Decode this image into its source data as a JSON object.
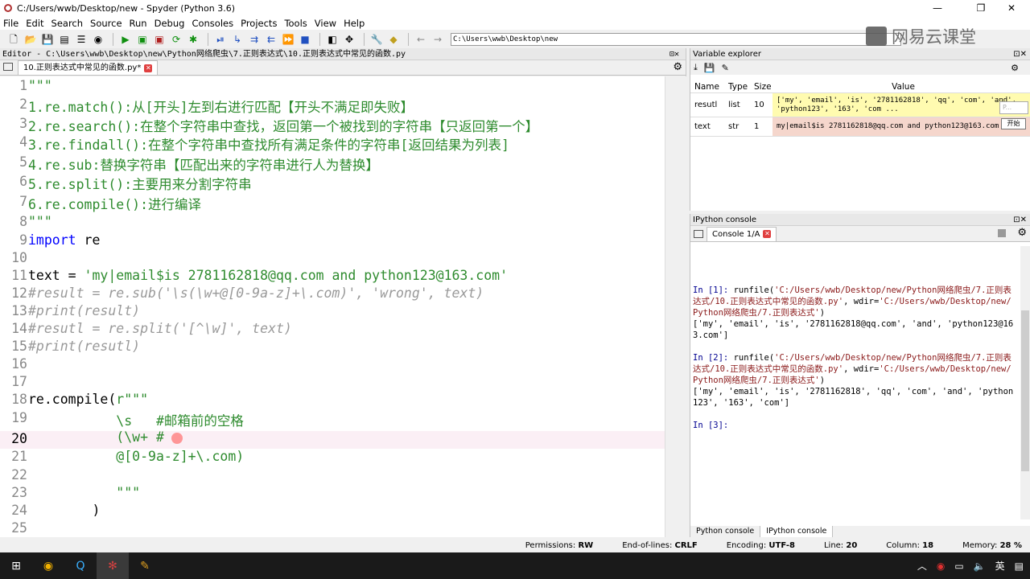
{
  "window": {
    "title": "C:/Users/wwb/Desktop/new - Spyder (Python 3.6)",
    "minimize": "—",
    "maximize": "❐",
    "close": "✕"
  },
  "menu": [
    "File",
    "Edit",
    "Search",
    "Source",
    "Run",
    "Debug",
    "Consoles",
    "Projects",
    "Tools",
    "View",
    "Help"
  ],
  "toolbar": {
    "path": "C:\\Users\\wwb\\Desktop\\new"
  },
  "watermark": "网易云课堂",
  "editor": {
    "header": "Editor - C:\\Users\\wwb\\Desktop\\new\\Python网络爬虫\\7.正则表达式\\10.正则表达式中常见的函数.py",
    "tab": "10.正则表达式中常见的函数.py*",
    "lines": [
      {
        "n": "1",
        "t": "\"\"\""
      },
      {
        "n": "2",
        "t": "1.re.match():从[开头]左到右进行匹配【开头不满足即失败】"
      },
      {
        "n": "3",
        "t": "2.re.search():在整个字符串中查找，返回第一个被找到的字符串【只返回第一个】"
      },
      {
        "n": "4",
        "t": "3.re.findall():在整个字符串中查找所有满足条件的字符串[返回结果为列表]"
      },
      {
        "n": "5",
        "t": "4.re.sub:替换字符串【匹配出来的字符串进行人为替换】"
      },
      {
        "n": "6",
        "t": "5.re.split():主要用来分割字符串"
      },
      {
        "n": "7",
        "t": "6.re.compile():进行编译"
      },
      {
        "n": "8",
        "t": "\"\"\""
      },
      {
        "n": "9",
        "kw": "import",
        "t": " re"
      },
      {
        "n": "10",
        "t": ""
      },
      {
        "n": "11",
        "pre": "text = ",
        "str": "'my|email$is 2781162818@qq.com and python123@163.com'"
      },
      {
        "n": "12",
        "cmt": "#result = re.sub('\\s(\\w+@[0-9a-z]+\\.com)', 'wrong', text)"
      },
      {
        "n": "13",
        "cmt": "#print(result)"
      },
      {
        "n": "14",
        "cmt": "#resutl = re.split('[^\\w]', text)"
      },
      {
        "n": "15",
        "cmt": "#print(resutl)"
      },
      {
        "n": "16",
        "t": ""
      },
      {
        "n": "17",
        "t": ""
      },
      {
        "n": "18",
        "pre": "re.compile(",
        "str": "r\"\"\""
      },
      {
        "n": "19",
        "str": "           \\s   #邮箱前的空格"
      },
      {
        "n": "20",
        "str": "           (\\w+ #"
      },
      {
        "n": "21",
        "str": "           @[0-9a-z]+\\.com)"
      },
      {
        "n": "22",
        "t": ""
      },
      {
        "n": "23",
        "str": "           \"\"\""
      },
      {
        "n": "24",
        "t": "        )"
      },
      {
        "n": "25",
        "t": ""
      }
    ]
  },
  "varx": {
    "title": "Variable explorer",
    "cols": [
      "Name",
      "Type",
      "Size",
      "Value"
    ],
    "rows": [
      {
        "name": "resutl",
        "type": "list",
        "size": "10",
        "value": "['my', 'email', 'is', '2781162818', 'qq', 'com', 'and', 'python123', '163', 'com ..."
      },
      {
        "name": "text",
        "type": "str",
        "size": "1",
        "value": "my|email$is 2781162818@qq.com and python123@163.com"
      }
    ],
    "popup": "P...",
    "start": "开始"
  },
  "console": {
    "title": "IPython console",
    "tab": "Console 1/A",
    "in1": "In [1]: ",
    "cmd1a": "runfile(",
    "path1": "'C:/Users/wwb/Desktop/new/Python网络爬虫/7.正则表达式/10.正则表达式中常见的函数.py'",
    "wd1": ", wdir=",
    "wpath1": "'C:/Users/wwb/Desktop/new/Python网络爬虫/7.正则表达式'",
    "out1": "['my', 'email', 'is', '2781162818@qq.com', 'and', 'python123@163.com']",
    "in2": "In [2]: ",
    "out2": "['my', 'email', 'is', '2781162818', 'qq', 'com', 'and', 'python123', '163', 'com']",
    "in3": "In [3]: ",
    "bottom_tabs": [
      "Python console",
      "IPython console"
    ]
  },
  "status": {
    "permissions_label": "Permissions:",
    "permissions": "RW",
    "eol_label": "End-of-lines:",
    "eol": "CRLF",
    "enc_label": "Encoding:",
    "enc": "UTF-8",
    "line_label": "Line:",
    "line": "20",
    "col_label": "Column:",
    "col": "18",
    "mem_label": "Memory:",
    "mem": "28 %"
  },
  "tray": {
    "lang": "英"
  }
}
